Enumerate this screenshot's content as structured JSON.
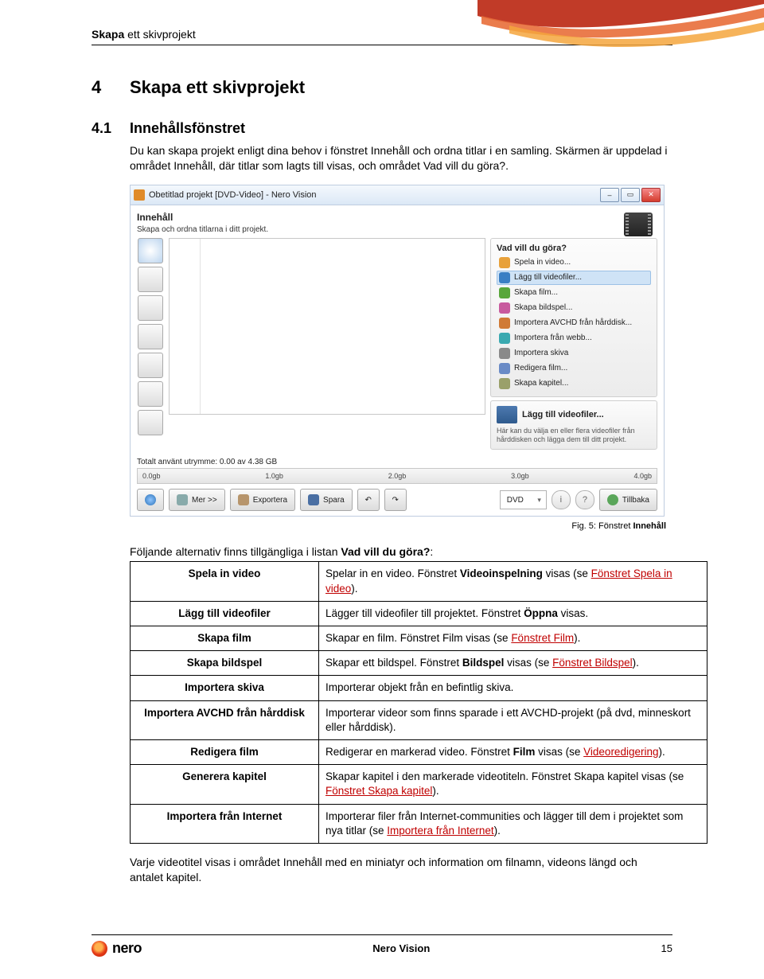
{
  "header": {
    "bold": "Skapa",
    "rest": "ett skivprojekt"
  },
  "h1": {
    "num": "4",
    "text": "Skapa ett skivprojekt"
  },
  "h2": {
    "num": "4.1",
    "text": "Innehållsfönstret"
  },
  "intro": "Du kan skapa projekt enligt dina behov i fönstret Innehåll och ordna titlar i en samling. Skärmen är uppdelad i området Innehåll, där titlar som lagts till visas, och området Vad vill du göra?.",
  "win": {
    "title": "Obetitlad projekt [DVD-Video] - Nero Vision",
    "section": "Innehåll",
    "subtitle": "Skapa och ordna titlarna i ditt projekt.",
    "actions_title": "Vad vill du göra?",
    "actions": [
      "Spela in video...",
      "Lägg till videofiler...",
      "Skapa film...",
      "Skapa bildspel...",
      "Importera AVCHD från hårddisk...",
      "Importera från webb...",
      "Importera skiva",
      "Redigera film...",
      "Skapa kapitel..."
    ],
    "hint_title": "Lägg till videofiler...",
    "hint_text": "Här kan du välja en eller flera videofiler från hårddisken och lägga dem till ditt projekt.",
    "usage": "Totalt använt utrymme: 0.00 av 4.38 GB",
    "ruler": [
      "0.0gb",
      "1.0gb",
      "2.0gb",
      "3.0gb",
      "4.0gb"
    ],
    "btn_more": "Mer >>",
    "btn_export": "Exportera",
    "btn_save": "Spara",
    "btn_back": "Tillbaka",
    "disc_type": "DVD"
  },
  "caption": {
    "pre": "Fig. 5: Fönstret ",
    "bold": "Innehåll"
  },
  "tbl_intro": {
    "pre": "Följande alternativ finns tillgängliga i listan ",
    "bold": "Vad vill du göra?",
    "post": ":"
  },
  "rows": [
    {
      "l": "Spela in video",
      "a": "Spelar in en video. Fönstret ",
      "b": "Videoinspelning",
      "c": " visas (se ",
      "link": "Fönstret Spela in video",
      "d": ")."
    },
    {
      "l": "Lägg till videofiler",
      "a": "Lägger till videofiler till projektet. Fönstret ",
      "b": "Öppna",
      "c": " visas."
    },
    {
      "l": "Skapa film",
      "a": "Skapar en film. Fönstret Film visas (se ",
      "link": "Fönstret Film",
      "d": ")."
    },
    {
      "l": "Skapa bildspel",
      "a": "Skapar ett bildspel. Fönstret ",
      "b": "Bildspel",
      "c": " visas (se ",
      "link": "Fönstret Bildspel",
      "d": ")."
    },
    {
      "l": "Importera skiva",
      "a": "Importerar objekt från en befintlig skiva."
    },
    {
      "l": "Importera AVCHD från hårddisk",
      "a": "Importerar videor som finns sparade i ett AVCHD-projekt (på dvd, minneskort eller hårddisk)."
    },
    {
      "l": "Redigera film",
      "a": "Redigerar en markerad video. Fönstret ",
      "b": "Film",
      "c": " visas (se ",
      "link": "Videoredigering",
      "d": ")."
    },
    {
      "l": "Generera kapitel",
      "a": "Skapar kapitel i den markerade videotiteln. Fönstret Skapa kapitel visas (se ",
      "link": "Fönstret Skapa kapitel",
      "d": ")."
    },
    {
      "l": "Importera från Internet",
      "a": "Importerar filer från Internet-communities och lägger till dem i projektet som nya titlar (se ",
      "link": "Importera från Internet",
      "d": ")."
    }
  ],
  "after": "Varje videotitel visas i området Innehåll med en miniatyr och information om filnamn, videons längd och antalet kapitel.",
  "footer": {
    "logo": "nero",
    "center": "Nero Vision",
    "page": "15"
  }
}
